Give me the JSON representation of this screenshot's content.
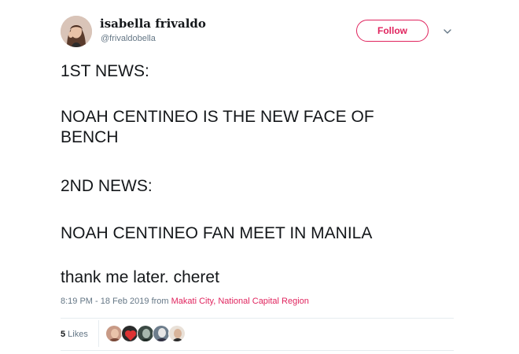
{
  "author": {
    "display_name": "isabella frivaldo",
    "handle": "@frivaldobella",
    "avatar_icon": "user-avatar-photo"
  },
  "header": {
    "follow_label": "Follow",
    "more_icon": "chevron-down-icon"
  },
  "tweet": {
    "lines": [
      "1ST NEWS:",
      "NOAH CENTINEO IS THE NEW FACE OF",
      "BENCH",
      "2ND NEWS:",
      "NOAH CENTINEO FAN MEET IN MANILA",
      "thank me later. cheret"
    ]
  },
  "meta": {
    "timestamp": "8:19 PM - 18 Feb 2019",
    "from": " from ",
    "location": "Makati City, National Capital Region"
  },
  "stats": {
    "likes_count": "5",
    "likes_label": " Likes",
    "liker_avatars": [
      "liker-avatar-1",
      "liker-avatar-2",
      "liker-avatar-3",
      "liker-avatar-4",
      "liker-avatar-5"
    ]
  },
  "colors": {
    "accent": "#e0245e",
    "muted": "#657786",
    "text": "#14171a",
    "divider": "#e6ecf0"
  }
}
